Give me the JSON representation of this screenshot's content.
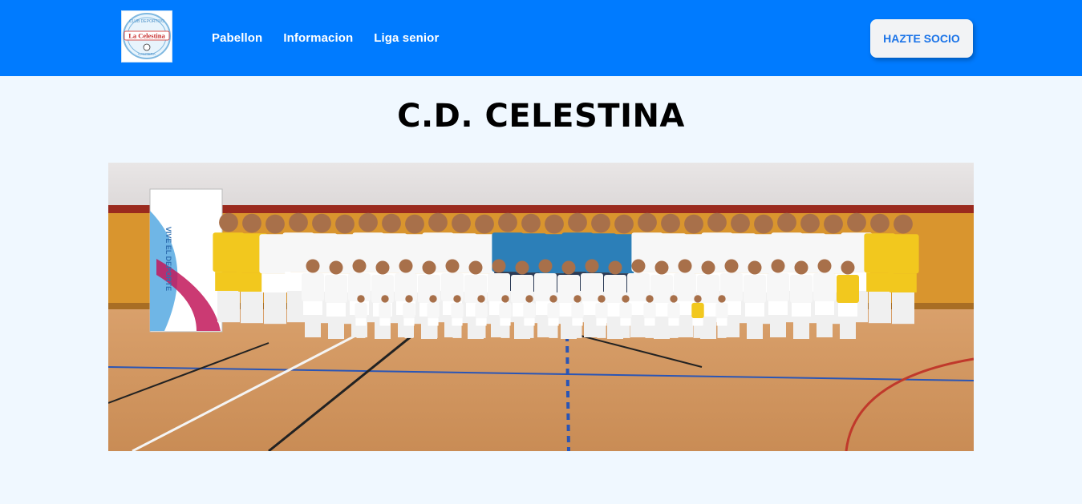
{
  "header": {
    "logo": {
      "alt": "La Celestina",
      "text_top": "CLUB DEPORTIVO",
      "text_main": "La Celestina",
      "text_bottom": "CANTERA"
    },
    "nav": [
      {
        "label": "Pabellon"
      },
      {
        "label": "Informacion"
      },
      {
        "label": "Liga senior"
      }
    ],
    "cta_label": "HAZTE SOCIO"
  },
  "main": {
    "title": "C.D. CELESTINA",
    "team_photo": {
      "alt": "C.D. Celestina team photo",
      "banner_text": "VIVE EL DEPORTE"
    }
  },
  "colors": {
    "navbar": "#007bff",
    "page_background": "#f0f8ff",
    "cta_text": "#1a73e8",
    "cta_background": "#f2f3f5"
  }
}
